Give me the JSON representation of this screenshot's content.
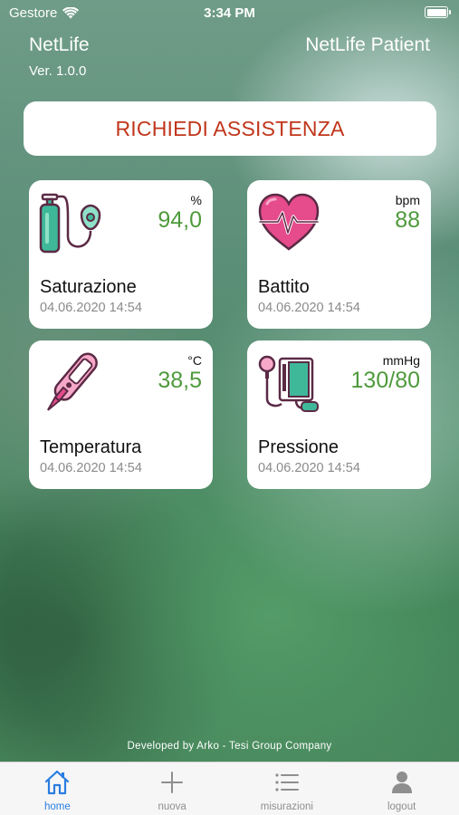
{
  "status_bar": {
    "carrier": "Gestore",
    "time": "3:34 PM",
    "battery_level": 1.0
  },
  "header": {
    "app_name": "NetLife",
    "version": "Ver. 1.0.0",
    "patient_label": "NetLife Patient"
  },
  "assist_button": {
    "label": "RICHIEDI ASSISTENZA",
    "color": "#c0361b"
  },
  "cards": [
    {
      "name": "Saturazione",
      "unit": "%",
      "value": "94,0",
      "date": "04.06.2020 14:54",
      "icon": "oxygen-tank-icon"
    },
    {
      "name": "Battito",
      "unit": "bpm",
      "value": "88",
      "date": "04.06.2020 14:54",
      "icon": "heart-rate-icon"
    },
    {
      "name": "Temperatura",
      "unit": "°C",
      "value": "38,5",
      "date": "04.06.2020 14:54",
      "icon": "thermometer-icon"
    },
    {
      "name": "Pressione",
      "unit": "mmHg",
      "value": "130/80",
      "date": "04.06.2020 14:54",
      "icon": "blood-pressure-icon"
    }
  ],
  "footer": {
    "credit": "Developed by Arko - Tesi Group Company"
  },
  "tab_bar": {
    "active_color": "#2a7de1",
    "tabs": [
      {
        "label": "home",
        "icon": "home-icon",
        "active": true
      },
      {
        "label": "nuova",
        "icon": "plus-icon",
        "active": false
      },
      {
        "label": "misurazioni",
        "icon": "list-icon",
        "active": false
      },
      {
        "label": "logout",
        "icon": "person-icon",
        "active": false
      }
    ]
  },
  "colors": {
    "value_green": "#4f9a3c",
    "icon_dark": "#5b2a45",
    "icon_teal": "#3fb89a",
    "icon_pink": "#e64b8c"
  }
}
